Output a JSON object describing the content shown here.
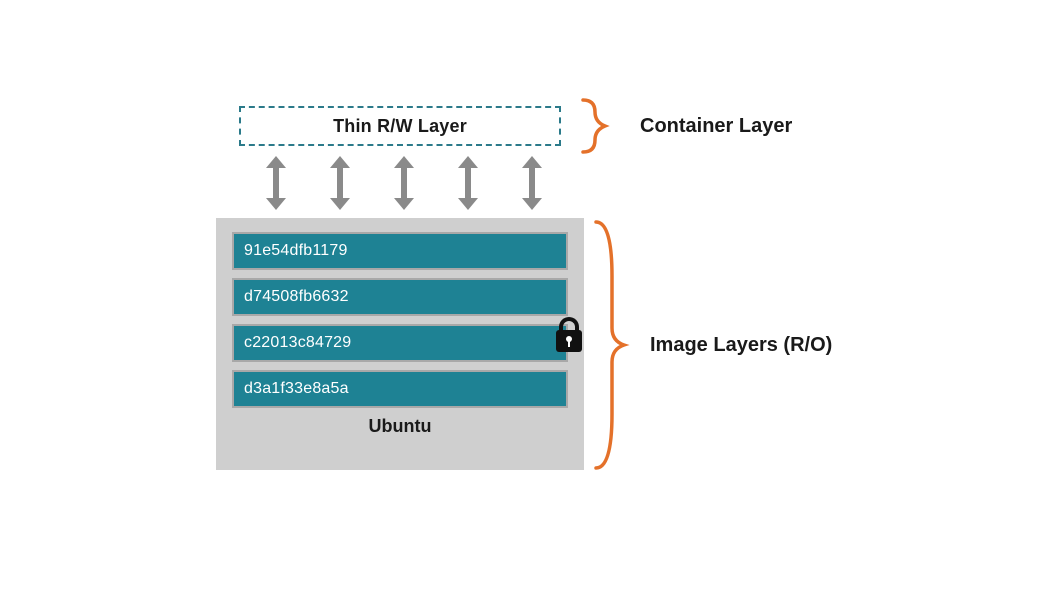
{
  "rw_layer": {
    "label": "Thin R/W Layer"
  },
  "labels": {
    "container_layer": "Container Layer",
    "image_layers": "Image Layers (R/O)"
  },
  "image_block": {
    "caption": "Ubuntu",
    "layers": [
      {
        "id": "91e54dfb1179"
      },
      {
        "id": "d74508fb6632"
      },
      {
        "id": "c22013c84729"
      },
      {
        "id": "d3a1f33e8a5a"
      }
    ]
  },
  "colors": {
    "layer_fill": "#1e8294",
    "block_bg": "#cfcfcf",
    "dash_border": "#2b7a8a",
    "arrow": "#8a8a8a",
    "brace": "#e4712a"
  }
}
